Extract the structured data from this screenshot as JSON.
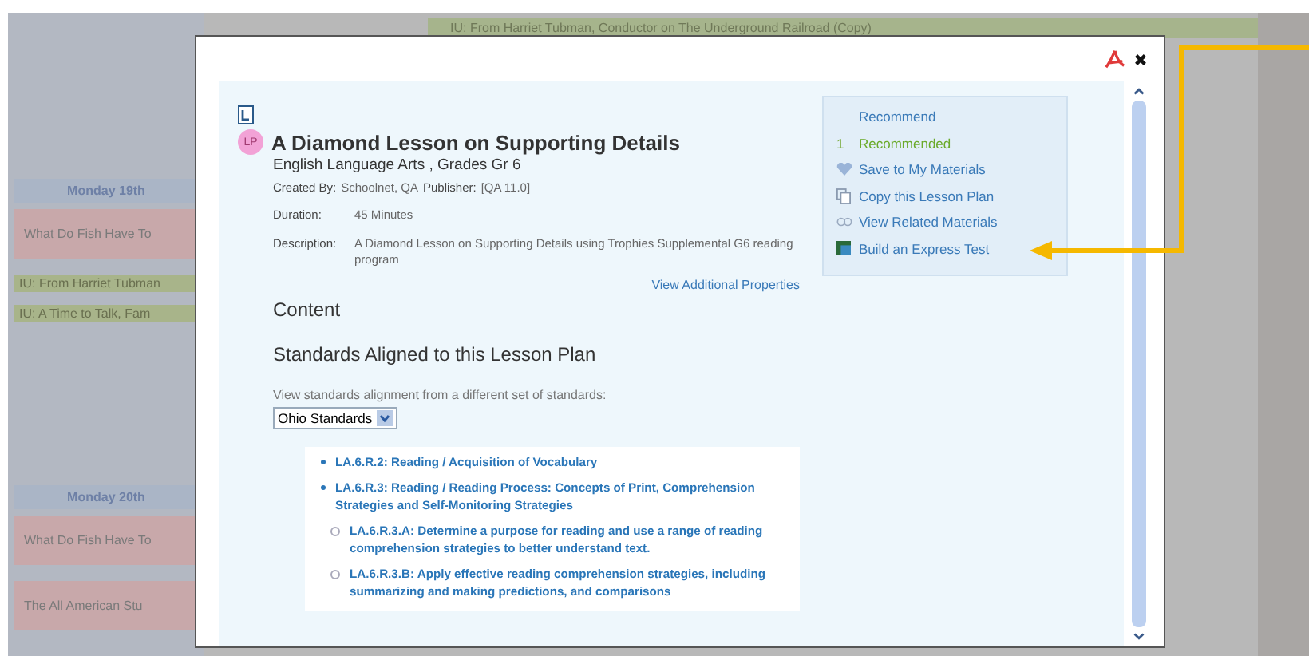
{
  "background": {
    "top_bar": "IU: From Harriet Tubman, Conductor on The Underground Railroad (Copy)",
    "days": [
      {
        "heading": "Monday 19th",
        "entries": [
          {
            "kind": "lesson",
            "text": "What Do Fish Have To"
          },
          {
            "kind": "unit",
            "text": "IU: From Harriet Tubman"
          },
          {
            "kind": "unit",
            "text": "IU: A Time to Talk, Fam"
          }
        ]
      },
      {
        "heading": "Monday 20th",
        "entries": [
          {
            "kind": "lesson",
            "text": "What Do Fish Have To"
          },
          {
            "kind": "lesson",
            "text": "The All American Stu"
          }
        ]
      }
    ]
  },
  "dialog": {
    "badge": "LP",
    "title": "A Diamond Lesson on Supporting Details",
    "subject": "English Language Arts , Grades Gr 6",
    "created_by_label": "Created By:",
    "created_by": "Schoolnet, QA",
    "publisher_label": "Publisher:",
    "publisher": "[QA 11.0]",
    "properties": [
      {
        "label": "Duration:",
        "value": "45 Minutes"
      },
      {
        "label": "Description:",
        "value": "A Diamond Lesson on Supporting Details using Trophies Supplemental G6 reading program"
      }
    ],
    "more_link": "View Additional Properties",
    "content_heading": "Content",
    "standards_heading": "Standards Aligned to this Lesson Plan",
    "standards_prompt": "View standards alignment from a different set of standards:",
    "standards_select": "Ohio Standards",
    "standards": [
      {
        "text": "LA.6.R.2: Reading / Acquisition of Vocabulary"
      },
      {
        "text": "LA.6.R.3: Reading / Reading Process: Concepts of Print, Comprehension Strategies and Self-Monitoring Strategies",
        "children": [
          {
            "text": "LA.6.R.3.A: Determine a purpose for reading and use a range of reading comprehension strategies to better understand text."
          },
          {
            "text": "LA.6.R.3.B: Apply effective reading comprehension strategies, including summarizing and making predictions, and comparisons"
          }
        ]
      }
    ],
    "actions": [
      {
        "kind": "recommend",
        "label": "Recommend"
      },
      {
        "kind": "count",
        "count": "1",
        "label": "Recommended"
      },
      {
        "kind": "save",
        "label": "Save to My Materials"
      },
      {
        "kind": "copy",
        "label": "Copy this Lesson Plan"
      },
      {
        "kind": "related",
        "label": "View Related Materials"
      },
      {
        "kind": "test",
        "label": "Build an Express Test"
      }
    ]
  }
}
